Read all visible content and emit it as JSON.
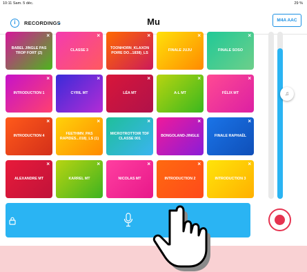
{
  "status_bar": {
    "time": "10:11  Sam. 5 déc.",
    "status": "29 %"
  },
  "header": {
    "menu_label": "RECORDINGS",
    "menu_chevron": "⌄",
    "title": "Mu",
    "format_button": "M4A AAC"
  },
  "pads": [
    {
      "label": "BABEL JINGLE PAS TROP FORT (2)",
      "gradient": [
        "#d6159a",
        "#4cb61c"
      ]
    },
    {
      "label": "CLASSE 3",
      "gradient": [
        "#f43bb0",
        "#ff5a5f"
      ]
    },
    {
      "label": "TOONHORN_KLAXON POIRE DO...1838)_LS",
      "gradient": [
        "#ff6a00",
        "#cc1a5a"
      ]
    },
    {
      "label": "FINALE JUJU",
      "gradient": [
        "#ffe10a",
        "#ff8a00"
      ]
    },
    {
      "label": "FINALE SOSO",
      "gradient": [
        "#20c997",
        "#6dcf8a"
      ]
    },
    {
      "label": "INTRODUCTION 1",
      "gradient": [
        "#c513c9",
        "#ff4070"
      ]
    },
    {
      "label": "CYRIL MT",
      "gradient": [
        "#3a2bd8",
        "#b42cd6"
      ]
    },
    {
      "label": "LÉA MT",
      "gradient": [
        "#d8163a",
        "#b0124a"
      ]
    },
    {
      "label": "A-L MT",
      "gradient": [
        "#b8d410",
        "#3ab81e"
      ]
    },
    {
      "label": "FÉLIX MT",
      "gradient": [
        "#ff4a93",
        "#dc1fa3"
      ]
    },
    {
      "label": "INTRODUCTION 4",
      "gradient": [
        "#ff5a1a",
        "#d32f1a"
      ]
    },
    {
      "label": "FEETHMN_PAS RAPIDES...018)_LS (1)",
      "gradient": [
        "#ffd20a",
        "#ff8a00"
      ]
    },
    {
      "label": "MICROTROTTOIR TDF CLASSE 001",
      "gradient": [
        "#1fbf9a",
        "#3ab4f0"
      ]
    },
    {
      "label": "BONGOLAND-JINGLE",
      "gradient": [
        "#f01a9a",
        "#8a1cd8"
      ]
    },
    {
      "label": "FINALE RAPHAËL",
      "gradient": [
        "#1a74e8",
        "#0f4fb8"
      ]
    },
    {
      "label": "ALEXANDRE MT",
      "gradient": [
        "#e81a3a",
        "#c0133a"
      ]
    },
    {
      "label": "KARREL MT",
      "gradient": [
        "#b8d412",
        "#3eb320"
      ]
    },
    {
      "label": "NICOLAS MT",
      "gradient": [
        "#ff3fa0",
        "#e8188a"
      ]
    },
    {
      "label": "INTRODUCTION 2",
      "gradient": [
        "#ff6a10",
        "#ff4a1a"
      ]
    },
    {
      "label": "INTRODUCTION 3",
      "gradient": [
        "#ffe40a",
        "#ffb000"
      ]
    }
  ],
  "volume_levels": [
    0.0,
    0.9
  ],
  "colors": {
    "accent": "#1a8fe3",
    "record": "#e53350",
    "record_bar": "#2ab4f3"
  },
  "icons": {
    "info": "info-icon",
    "lock": "lock-icon",
    "mic": "microphone-icon",
    "record": "record-icon",
    "music": "music-note-icon"
  }
}
